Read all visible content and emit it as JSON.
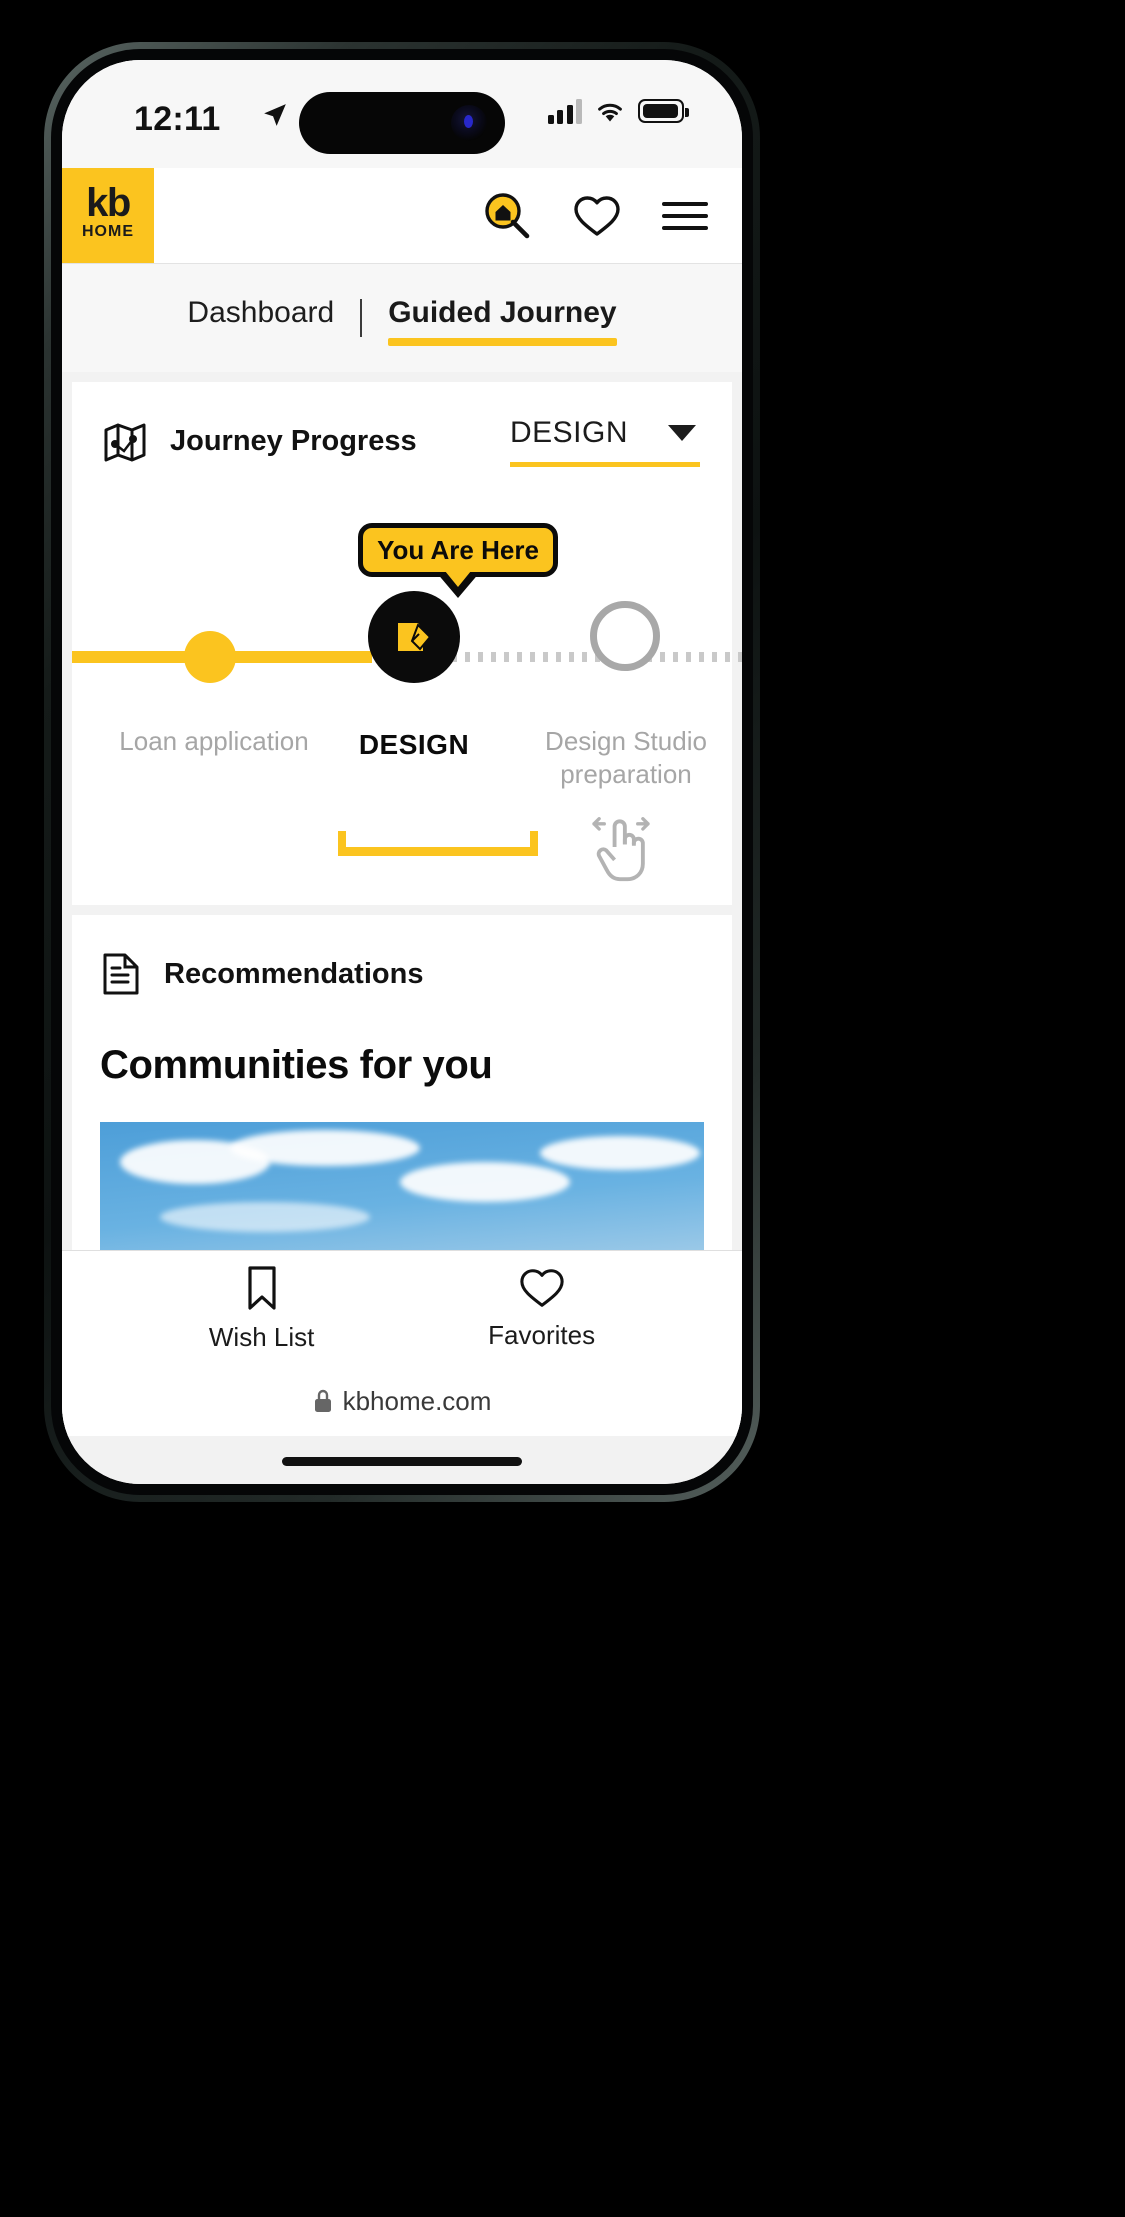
{
  "status_bar": {
    "time": "12:11",
    "location_icon": "location-arrow-icon",
    "signal_icon": "cellular-signal-icon",
    "wifi_icon": "wifi-icon",
    "battery_icon": "battery-icon"
  },
  "header": {
    "logo_primary": "kb",
    "logo_secondary": "HOME",
    "search_icon": "search-home-icon",
    "favorites_icon": "heart-icon",
    "menu_icon": "hamburger-menu-icon",
    "brand_yellow": "#fbc41f"
  },
  "tabs": {
    "dashboard_label": "Dashboard",
    "separator": "|",
    "guided_journey_label": "Guided Journey",
    "active": "Guided Journey"
  },
  "journey": {
    "icon": "map-icon",
    "title": "Journey Progress",
    "stage_selected": "DESIGN",
    "caret_icon": "chevron-down-icon",
    "badge": "You Are Here",
    "steps": [
      {
        "label": "Loan application",
        "state": "completed"
      },
      {
        "label": "DESIGN",
        "state": "current"
      },
      {
        "label": "Design Studio preparation",
        "state": "upcoming"
      }
    ],
    "current_node_icon": "design-folder-icon",
    "swipe_icon": "swipe-hand-icon"
  },
  "recommendations": {
    "icon": "document-icon",
    "section_title": "Recommendations",
    "heading": "Communities for you",
    "photo_alt": "community-home-photo"
  },
  "bottom_nav": {
    "items": [
      {
        "label": "Wish List",
        "icon": "bookmark-icon"
      },
      {
        "label": "Favorites",
        "icon": "heart-icon"
      }
    ]
  },
  "browser": {
    "lock_icon": "lock-icon",
    "url": "kbhome.com"
  }
}
